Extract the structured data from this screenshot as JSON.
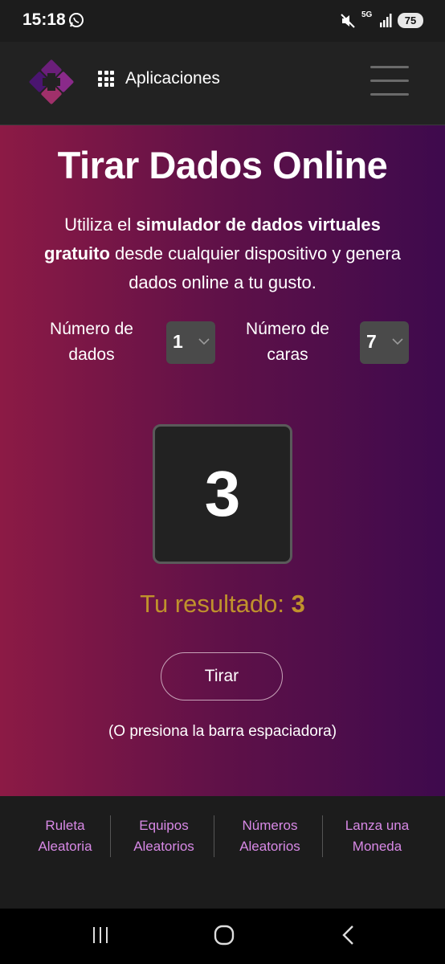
{
  "status_bar": {
    "time": "15:18",
    "network": "5G",
    "battery": "75",
    "icons": [
      "whatsapp-icon",
      "mute-icon",
      "signal-icon",
      "battery-icon"
    ]
  },
  "header": {
    "apps_label": "Aplicaciones",
    "icons": [
      "logo-icon",
      "grid-icon",
      "hamburger-menu-icon"
    ]
  },
  "hero": {
    "title": "Tirar Dados Online",
    "intro_prefix": "Utiliza el ",
    "intro_bold": "simulador de dados virtuales gratuito",
    "intro_suffix": " desde cualquier dispositivo y genera dados online a tu gusto."
  },
  "controls": {
    "dice_label_line1": "Número de",
    "dice_label_line2": "dados",
    "dice_value": "1",
    "faces_label_line1": "Número de",
    "faces_label_line2": "caras",
    "faces_value": "7"
  },
  "result": {
    "die_value": "3",
    "label": "Tu resultado: ",
    "value": "3",
    "roll_button": "Tirar",
    "hint": "(O presiona la barra espaciadora)"
  },
  "footer": {
    "links": [
      {
        "line1": "Ruleta",
        "line2": "Aleatoria"
      },
      {
        "line1": "Equipos",
        "line2": "Aleatorios"
      },
      {
        "line1": "Números",
        "line2": "Aleatorios"
      },
      {
        "line1": "Lanza una",
        "line2": "Moneda"
      }
    ]
  },
  "colors": {
    "gradient_start": "#8c1a45",
    "gradient_end": "#3e0a4d",
    "result_color": "#c0922c",
    "footer_link": "#d889e6"
  }
}
